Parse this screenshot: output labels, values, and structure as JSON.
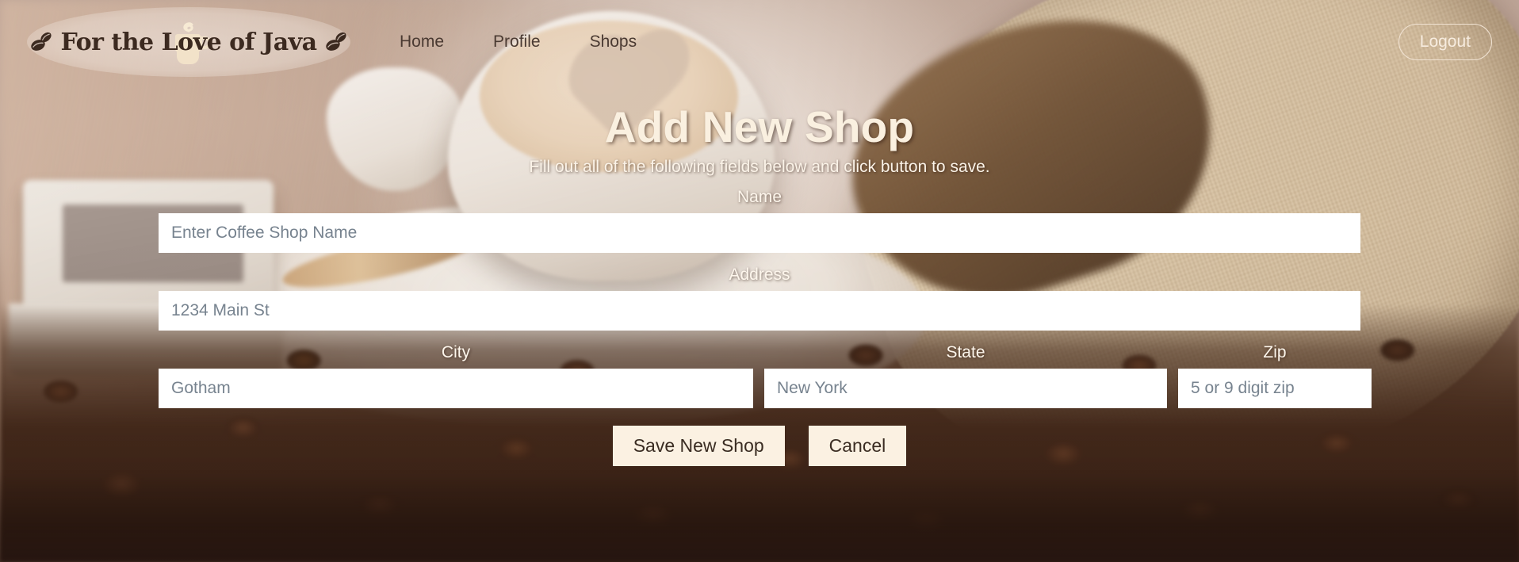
{
  "navbar": {
    "brand": {
      "text": "For the Love of Java",
      "left_bean_icon": "coffee-bean-icon",
      "right_bean_icon": "coffee-bean-icon",
      "cup_icon": "coffee-cup-icon"
    },
    "links": [
      {
        "label": "Home"
      },
      {
        "label": "Profile"
      },
      {
        "label": "Shops"
      }
    ],
    "logout_label": "Logout"
  },
  "page": {
    "title": "Add New Shop",
    "subtitle": "Fill out all of the following fields below and click button to save."
  },
  "form": {
    "name": {
      "label": "Name",
      "placeholder": "Enter Coffee Shop Name",
      "value": ""
    },
    "address": {
      "label": "Address",
      "placeholder": "1234 Main St",
      "value": ""
    },
    "city": {
      "label": "City",
      "placeholder": "Gotham",
      "value": ""
    },
    "state": {
      "label": "State",
      "placeholder": "New York",
      "value": ""
    },
    "zip": {
      "label": "Zip",
      "placeholder": "5 or 9 digit zip",
      "value": ""
    },
    "save_label": "Save New Shop",
    "cancel_label": "Cancel"
  },
  "colors": {
    "cream": "#FAF0E0",
    "button_bg": "#FBF1E2",
    "input_bg": "#FFFFFF",
    "placeholder": "#77838F",
    "nav_link": "#4A3A32",
    "brand_text": "#3C2A20"
  }
}
